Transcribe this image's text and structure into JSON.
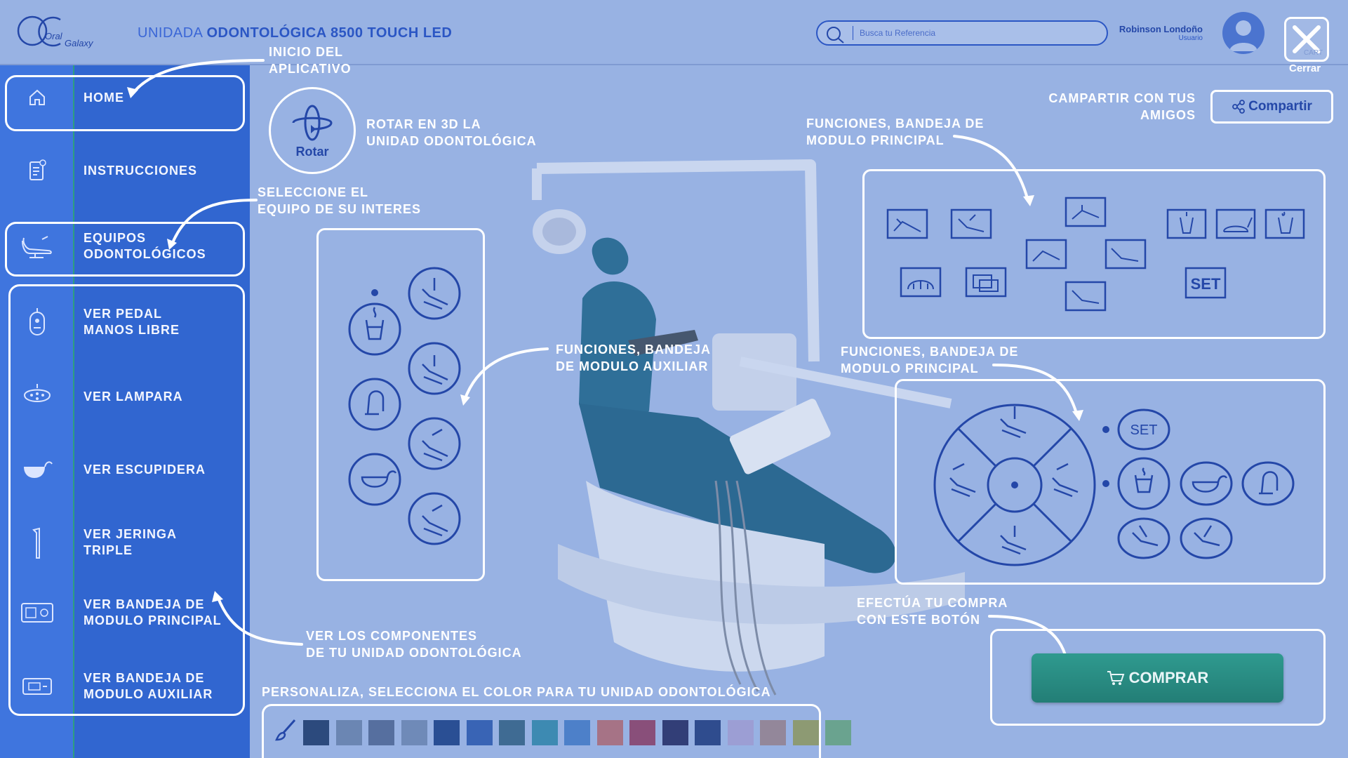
{
  "header": {
    "title_lite": "UNIDADA ",
    "title_bold": "ODONTOLÓGICA 8500 TOUCH LED",
    "search_placeholder": "Busca tu Referencia",
    "user_name": "Robinson Londoño",
    "user_role": "Usuario",
    "close_ghost": "CART",
    "close_label": "Cerrar"
  },
  "sidebar": {
    "items": [
      {
        "label": "HOME",
        "icon": "home-icon"
      },
      {
        "label": "INSTRUCCIONES",
        "icon": "instructions-icon"
      },
      {
        "label_1": "EQUIPOS",
        "label_2": "ODONTOLÓGICOS",
        "icon": "dental-chair-icon"
      },
      {
        "label_1": "VER PEDAL",
        "label_2": "MANOS LIBRE",
        "icon": "pedal-icon"
      },
      {
        "label": "VER LAMPARA",
        "icon": "lamp-icon"
      },
      {
        "label": "VER ESCUPIDERA",
        "icon": "spittoon-icon"
      },
      {
        "label_1": "VER JERINGA",
        "label_2": "TRIPLE",
        "icon": "syringe-icon"
      },
      {
        "label_1": "VER BANDEJA DE",
        "label_2": "MODULO PRINCIPAL",
        "icon": "main-tray-icon"
      },
      {
        "label_1": "VER BANDEJA DE",
        "label_2": "MODULO AUXILIAR",
        "icon": "aux-tray-icon"
      }
    ]
  },
  "annotations": {
    "inicio_1": "INICIO DEL",
    "inicio_2": "APLICATIVO",
    "rotar_1": "ROTAR EN 3D LA",
    "rotar_2": "UNIDAD ODONTOLÓGICA",
    "seleccione_1": "SELECCIONE EL",
    "seleccione_2": "EQUIPO DE SU INTERES",
    "aux_1": "FUNCIONES, BANDEJA",
    "aux_2": "DE MODULO AUXILIAR",
    "main_top_1": "FUNCIONES, BANDEJA DE",
    "main_top_2": "MODULO PRINCIPAL",
    "main_bottom_1": "FUNCIONES, BANDEJA DE",
    "main_bottom_2": "MODULO PRINCIPAL",
    "share_1": "CAMPARTIR CON TUS",
    "share_2": "AMIGOS",
    "componentes_1": "VER LOS COMPONENTES",
    "componentes_2": "DE TU UNIDAD ODONTOLÓGICA",
    "compra_1": "EFECTÚA TU COMPRA",
    "compra_2": "CON ESTE BOTÓN",
    "personaliza": "PERSONALIZA, SELECCIONA EL COLOR PARA TU UNIDAD ODONTOLÓGICA"
  },
  "rotate": {
    "label": "Rotar"
  },
  "share": {
    "label": "Compartir"
  },
  "buy": {
    "label": "COMPRAR"
  },
  "main_panel_top": {
    "set_label": "SET"
  },
  "main_panel_bottom": {
    "set_label": "SET"
  },
  "colors": {
    "accent": "#2b56c4",
    "buy": "#2a8c85",
    "swatches": [
      "#2c4a7d",
      "#6b86b3",
      "#566f9f",
      "#6f8ab8",
      "#2a4f94",
      "#3964b5",
      "#3f6b93",
      "#3d8ab2",
      "#4d80c9",
      "#a67386",
      "#894f7a",
      "#323e77",
      "#2f4c8e",
      "#9c9ed4",
      "#93879a",
      "#8d9a73",
      "#6aa38f"
    ]
  }
}
